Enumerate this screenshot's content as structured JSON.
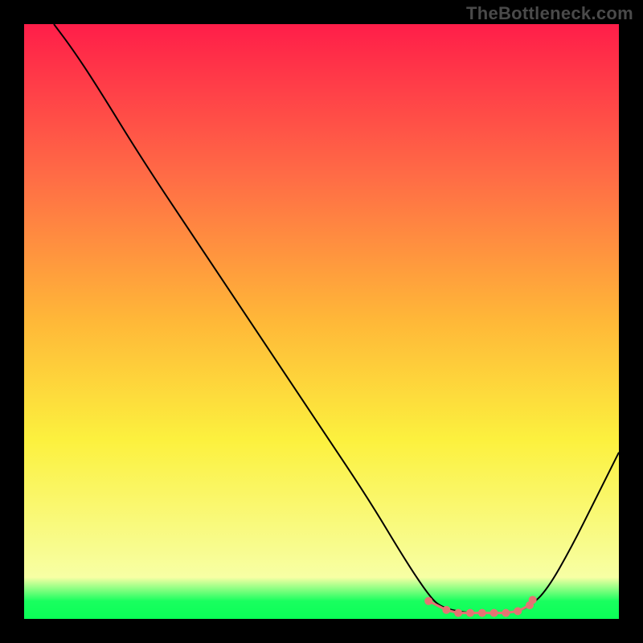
{
  "watermark": "TheBottleneck.com",
  "chart_data": {
    "type": "line",
    "title": "",
    "xlabel": "",
    "ylabel": "",
    "xlim": [
      0,
      100
    ],
    "ylim": [
      0,
      100
    ],
    "background_gradient": {
      "stops": [
        {
          "y": 0,
          "color": "#ff1e49"
        },
        {
          "y": 25,
          "color": "#ff6a46"
        },
        {
          "y": 50,
          "color": "#ffb838"
        },
        {
          "y": 70,
          "color": "#fcf13e"
        },
        {
          "y": 93,
          "color": "#f7ffa4"
        },
        {
          "y": 97,
          "color": "#19ff5f"
        },
        {
          "y": 100,
          "color": "#0aff57"
        }
      ]
    },
    "series": [
      {
        "name": "bottleneck-curve",
        "stroke": "#000000",
        "points": [
          {
            "x": 5,
            "y": 100
          },
          {
            "x": 8,
            "y": 96
          },
          {
            "x": 12,
            "y": 90
          },
          {
            "x": 20,
            "y": 77
          },
          {
            "x": 30,
            "y": 62
          },
          {
            "x": 40,
            "y": 47
          },
          {
            "x": 50,
            "y": 32
          },
          {
            "x": 58,
            "y": 20
          },
          {
            "x": 64,
            "y": 10
          },
          {
            "x": 68,
            "y": 4
          },
          {
            "x": 70,
            "y": 2
          },
          {
            "x": 74,
            "y": 1
          },
          {
            "x": 78,
            "y": 1
          },
          {
            "x": 82,
            "y": 1
          },
          {
            "x": 85,
            "y": 2
          },
          {
            "x": 88,
            "y": 5
          },
          {
            "x": 92,
            "y": 12
          },
          {
            "x": 96,
            "y": 20
          },
          {
            "x": 100,
            "y": 28
          }
        ]
      }
    ],
    "markers": {
      "name": "flat-min-markers",
      "color": "#e57373",
      "radius_px": 5,
      "points": [
        {
          "x": 68,
          "y": 3
        },
        {
          "x": 71,
          "y": 1.5
        },
        {
          "x": 73,
          "y": 1
        },
        {
          "x": 75,
          "y": 1
        },
        {
          "x": 77,
          "y": 1
        },
        {
          "x": 79,
          "y": 1
        },
        {
          "x": 81,
          "y": 1
        },
        {
          "x": 83,
          "y": 1.3
        },
        {
          "x": 85,
          "y": 2.3
        },
        {
          "x": 85.5,
          "y": 3.2
        }
      ]
    }
  }
}
